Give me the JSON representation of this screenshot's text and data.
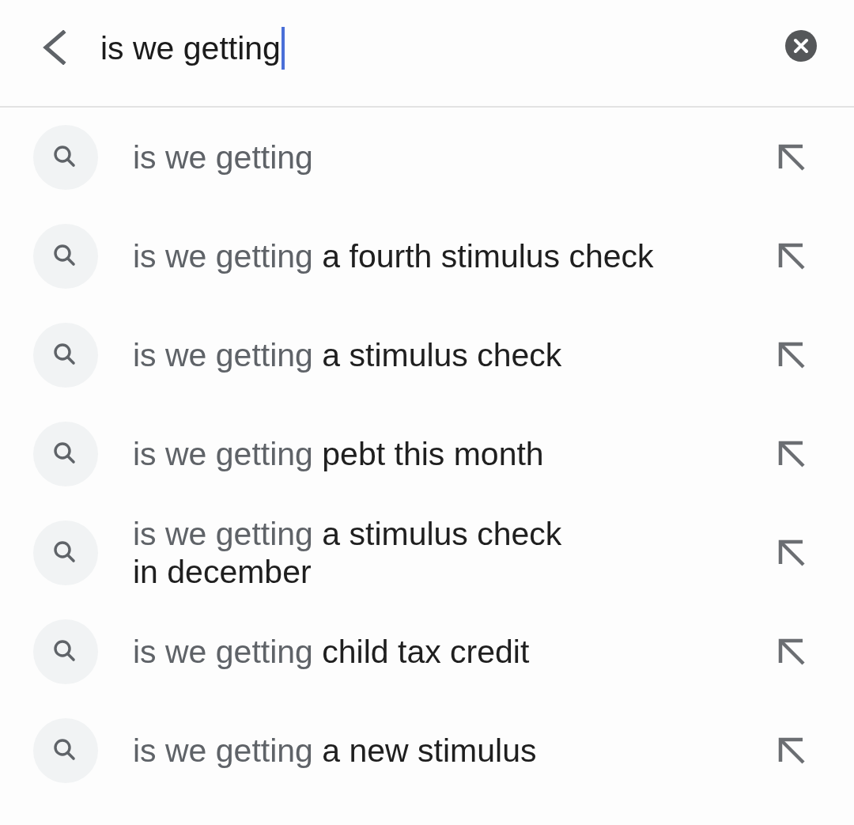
{
  "search_bar": {
    "value": "is we getting",
    "focused": true
  },
  "suggestions": [
    {
      "query": "is we getting"
    },
    {
      "query": "is we getting",
      "completion": "a fourth stimulus check"
    },
    {
      "query": "is we getting",
      "completion": "a stimulus check"
    },
    {
      "query": "is we getting",
      "completion": "pebt this month"
    },
    {
      "query": "is we getting",
      "completion": "a stimulus check\nin december"
    },
    {
      "query": "is we getting",
      "completion": "child tax credit"
    },
    {
      "query": "is we getting",
      "completion": "a new stimulus"
    }
  ]
}
